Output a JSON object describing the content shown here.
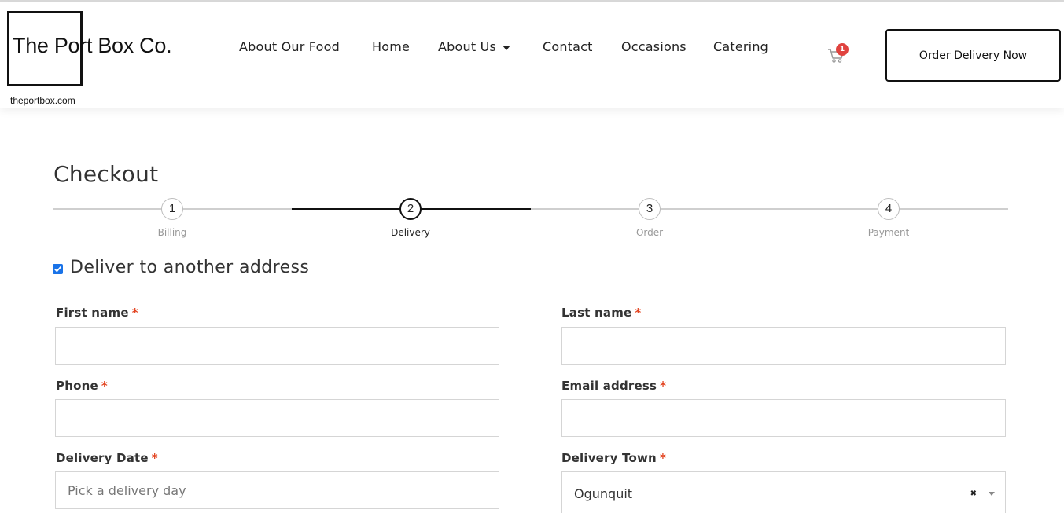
{
  "brand": {
    "name": "The Port Box Co.",
    "domain": "theportbox.com"
  },
  "nav": {
    "items": [
      {
        "label": "About Our Food"
      },
      {
        "label": "Home"
      },
      {
        "label": "About Us"
      },
      {
        "label": "Contact"
      },
      {
        "label": "Occasions"
      },
      {
        "label": "Catering"
      }
    ],
    "cart_count": "1",
    "cta_label": "Order Delivery Now"
  },
  "checkout": {
    "title": "Checkout",
    "steps": [
      {
        "number": "1",
        "label": "Billing"
      },
      {
        "number": "2",
        "label": "Delivery"
      },
      {
        "number": "3",
        "label": "Order"
      },
      {
        "number": "4",
        "label": "Payment"
      }
    ],
    "active_step": 2,
    "deliver_other": {
      "label": "Deliver to another address",
      "checked": true
    },
    "fields": {
      "first_name": {
        "label": "First name",
        "value": ""
      },
      "last_name": {
        "label": "Last name",
        "value": ""
      },
      "phone": {
        "label": "Phone",
        "value": ""
      },
      "email": {
        "label": "Email address",
        "value": ""
      },
      "delivery_date": {
        "label": "Delivery Date",
        "placeholder": "Pick a delivery day"
      },
      "delivery_town": {
        "label": "Delivery Town",
        "value": "Ogunquit"
      }
    },
    "required_mark": "*"
  },
  "colors": {
    "accent": "#111111",
    "required": "#e2401c",
    "badge": "#e0433f",
    "checkbox": "#1a73e8"
  }
}
